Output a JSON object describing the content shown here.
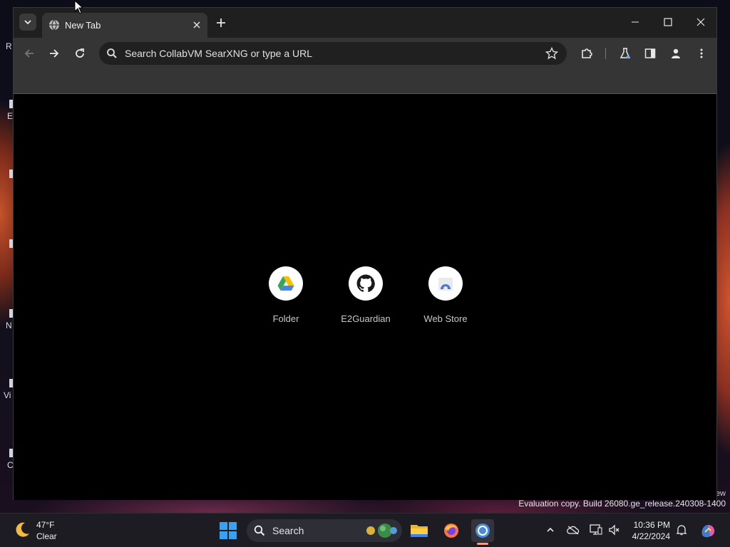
{
  "desktop": {
    "labels": [
      "R",
      "E",
      "N",
      "Vi",
      "C"
    ],
    "watermark_top": "ew",
    "watermark": "Evaluation copy. Build 26080.ge_release.240308-1400"
  },
  "browser": {
    "tab": {
      "title": "New Tab",
      "close_icon": "close-icon",
      "favicon": "globe-icon"
    },
    "new_tab_icon": "plus-icon",
    "window_controls": [
      "minimize-icon",
      "maximize-icon",
      "close-icon"
    ],
    "omnibox": {
      "placeholder": "Search CollabVM SearXNG or type a URL",
      "value": ""
    },
    "toolbar_icons": [
      "back-icon",
      "forward-icon",
      "reload-icon",
      "star-icon",
      "extensions-icon",
      "labs-icon",
      "side-panel-icon",
      "profile-icon",
      "menu-icon"
    ]
  },
  "ntp": {
    "shortcuts": [
      {
        "label": "Folder",
        "icon": "google-drive-icon"
      },
      {
        "label": "E2Guardian",
        "icon": "github-icon"
      },
      {
        "label": "Web Store",
        "icon": "web-store-icon"
      }
    ]
  },
  "taskbar": {
    "weather": {
      "temp": "47°F",
      "condition": "Clear",
      "icon": "moon-icon"
    },
    "search_label": "Search",
    "apps": [
      "file-explorer-icon",
      "firefox-icon",
      "chrome-icon"
    ],
    "tray_icons": [
      "chevron-up-icon",
      "onedrive-icon",
      "network-icon",
      "volume-muted-icon",
      "bell-icon",
      "copilot-icon"
    ],
    "clock": {
      "time": "10:36 PM",
      "date": "4/22/2024"
    }
  },
  "colors": {
    "accent_indicator": "#f29b8a",
    "omnibox_bg": "#202020",
    "toolbar_bg": "#353535",
    "ntp_bg": "#000000"
  }
}
